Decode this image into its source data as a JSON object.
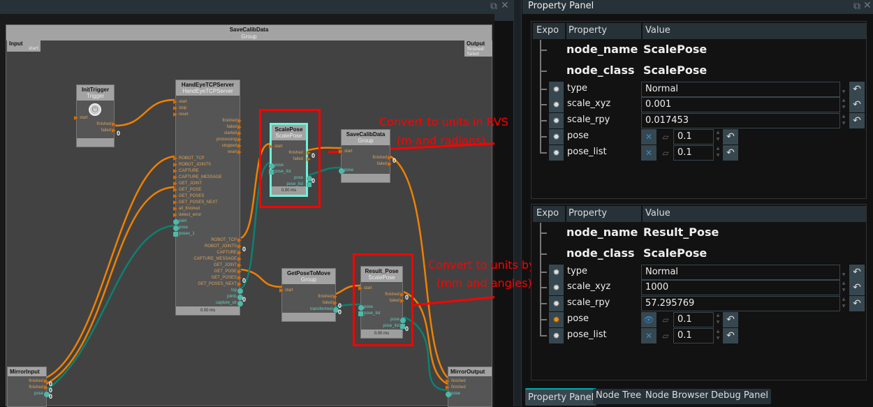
{
  "graph": {
    "group_title": "SaveCalibData",
    "group_class": "Group",
    "input_label": "Input",
    "input_port": "start",
    "output_label": "Output",
    "output_ports": [
      "finished",
      "failed"
    ],
    "nodes": [
      {
        "id": "init",
        "name": "InitTrigger",
        "cls": "Trigger",
        "icon": "power-icon",
        "ports": [
          [
            "in",
            "ev",
            "start"
          ],
          [
            "out",
            "ev",
            "finished"
          ],
          [
            "out",
            "ev",
            "failed",
            "0"
          ]
        ]
      },
      {
        "id": "hand",
        "name": "HandEyeTCPServer",
        "cls": "HandEyeTCPServer",
        "footer": "0.00 ms",
        "ports": [
          [
            "in",
            "ev",
            "start"
          ],
          [
            "in",
            "ev",
            "stop"
          ],
          [
            "in",
            "ev",
            "reset"
          ],
          [
            "out",
            "ev",
            "finished"
          ],
          [
            "out",
            "ev",
            "failed"
          ],
          [
            "out",
            "ev",
            "started"
          ],
          [
            "out",
            "ev",
            "processing"
          ],
          [
            "out",
            "ev",
            "stopped"
          ],
          [
            "out",
            "ev",
            "reset"
          ],
          [
            "in",
            "ev",
            "ROBOT_TCP"
          ],
          [
            "in",
            "ev",
            "ROBOT_JOINTS"
          ],
          [
            "in",
            "ev",
            "CAPTURE"
          ],
          [
            "in",
            "ev",
            "CAPTURE_MESSAGE"
          ],
          [
            "in",
            "ev",
            "GET_JOINT"
          ],
          [
            "in",
            "ev",
            "GET_POSE"
          ],
          [
            "in",
            "ev",
            "GET_POSES"
          ],
          [
            "in",
            "ev",
            "GET_POSES_NEXT"
          ],
          [
            "in",
            "ev",
            "all_finished"
          ],
          [
            "in",
            "ev",
            "detect_error"
          ],
          [
            "in",
            "dt",
            "joint"
          ],
          [
            "in",
            "dt",
            "pose"
          ],
          [
            "in",
            "ls",
            "poses_1"
          ],
          [
            "out",
            "ev",
            "ROBOT_TCP"
          ],
          [
            "out",
            "ev",
            "ROBOT_JOINTS",
            "0"
          ],
          [
            "out",
            "ev",
            "CAPTURE"
          ],
          [
            "out",
            "ev",
            "CAPTURE_MESSAGE"
          ],
          [
            "out",
            "ev",
            "GET_JOINT"
          ],
          [
            "out",
            "ev",
            "GET_POSE"
          ],
          [
            "out",
            "ev",
            "GET_POSES",
            "0"
          ],
          [
            "out",
            "ev",
            "GET_POSES_NEXT"
          ],
          [
            "out",
            "dt",
            "tcp"
          ],
          [
            "out",
            "dt",
            "joints",
            "0"
          ],
          [
            "out",
            "dt",
            "capture_str"
          ]
        ]
      },
      {
        "id": "scale",
        "name": "ScalePose",
        "cls": "ScalePose",
        "footer": "0.00 ms",
        "ports": [
          [
            "in",
            "ev",
            "start"
          ],
          [
            "out",
            "ev",
            "finished",
            "0"
          ],
          [
            "out",
            "ev",
            "failed"
          ],
          [
            "in",
            "dt",
            "pose"
          ],
          [
            "in",
            "ls",
            "pose_list"
          ],
          [
            "out",
            "dt",
            "pose",
            "0"
          ],
          [
            "out",
            "ls",
            "pose_list"
          ]
        ]
      },
      {
        "id": "save",
        "name": "SaveCalibData",
        "cls": "Group",
        "ports": [
          [
            "in",
            "ev",
            "start"
          ],
          [
            "out",
            "ev",
            "finished",
            "0"
          ],
          [
            "out",
            "ev",
            "failed"
          ],
          [
            "in",
            "dt",
            "pose"
          ]
        ]
      },
      {
        "id": "getp",
        "name": "GetPoseToMove",
        "cls": "Group",
        "ports": [
          [
            "in",
            "ev",
            "start"
          ],
          [
            "out",
            "ev",
            "finished"
          ],
          [
            "out",
            "ev",
            "failed",
            "0"
          ],
          [
            "out",
            "dt",
            "transformed",
            "0"
          ]
        ]
      },
      {
        "id": "result",
        "name": "Result_Pose",
        "cls": "ScalePose",
        "footer": "0.00 ms",
        "ports": [
          [
            "in",
            "ev",
            "start"
          ],
          [
            "out",
            "ev",
            "finished",
            "0"
          ],
          [
            "out",
            "ev",
            "failed"
          ],
          [
            "in",
            "dt",
            "pose"
          ],
          [
            "in",
            "ls",
            "pose_list"
          ],
          [
            "out",
            "dt",
            "pose"
          ],
          [
            "out",
            "ls",
            "pose_list",
            "0"
          ]
        ]
      },
      {
        "id": "mirin",
        "name": "MirrorInput",
        "cls": "",
        "ports": [
          [
            "out",
            "ev",
            "finished",
            "0"
          ],
          [
            "out",
            "ev",
            "finished",
            "0"
          ],
          [
            "out",
            "dt",
            "pose",
            "0"
          ]
        ]
      },
      {
        "id": "mirout",
        "name": "MirrorOutput",
        "cls": "",
        "ports": [
          [
            "in",
            "ev",
            "finished"
          ],
          [
            "in",
            "ev",
            "finished"
          ],
          [
            "in",
            "dt",
            "pose"
          ]
        ]
      }
    ],
    "annotations": [
      {
        "line1": "Convert to units in RVS",
        "line2": "(m and radians)"
      },
      {
        "line1": "Convert to units by the robot",
        "line2": "(mm and angles)"
      }
    ]
  },
  "property_panel": {
    "title": "Property Panel",
    "headers": [
      "Expo",
      "Property",
      "Value"
    ],
    "panels": [
      {
        "node_name": "ScalePose",
        "node_class": "ScalePose",
        "type": "Normal",
        "scale_xyz": "0.001",
        "scale_rpy": "0.017453",
        "pose": "0.1",
        "pose_list": "0.1",
        "pose_exposed": false
      },
      {
        "node_name": "Result_Pose",
        "node_class": "ScalePose",
        "type": "Normal",
        "scale_xyz": "1000",
        "scale_rpy": "57.295769",
        "pose": "0.1",
        "pose_list": "0.1",
        "pose_exposed": true
      }
    ],
    "labels": {
      "node_name": "node_name",
      "node_class": "node_class",
      "type": "type",
      "scale_xyz": "scale_xyz",
      "scale_rpy": "scale_rpy",
      "pose": "pose",
      "pose_list": "pose_list"
    }
  },
  "tabs": [
    "Property Panel",
    "Node Tree",
    "Node Browser",
    "Debug Panel"
  ],
  "active_tab": "Property Panel",
  "colors": {
    "event": "#d96b00",
    "data": "#4fb8a8",
    "selected": "#6ff3d8",
    "annotation": "#ff0000",
    "accent": "#00aaaa"
  }
}
